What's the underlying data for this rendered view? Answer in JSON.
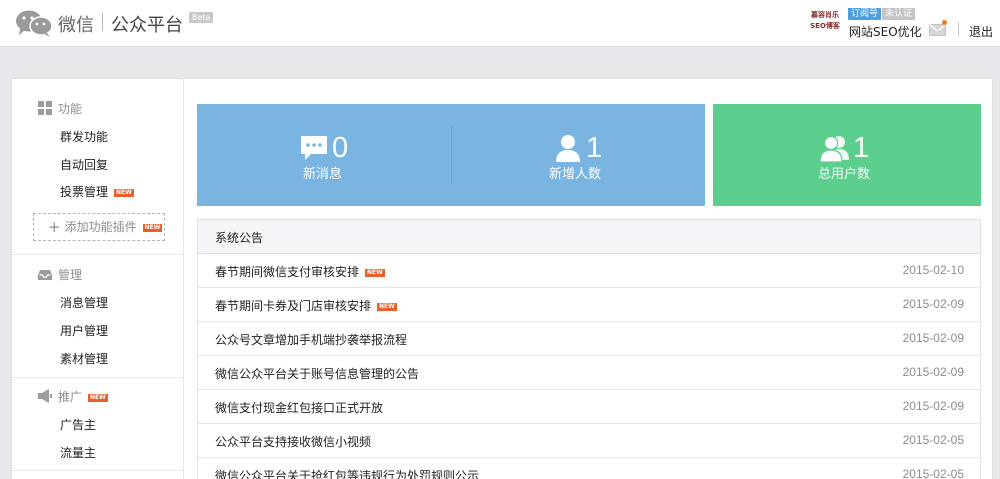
{
  "header": {
    "brand": "微信",
    "platform": "公众平台",
    "beta": "Beta",
    "account_logo_line1": "慕容肖乐",
    "account_logo_line2": "SEO博客",
    "account_type": "订阅号",
    "account_verify": "未认证",
    "account_name": "网站SEO优化",
    "logout": "退出"
  },
  "sidebar": {
    "groups": [
      {
        "title": "功能",
        "icon": "grid-icon"
      },
      {
        "title": "管理",
        "icon": "inbox-icon"
      },
      {
        "title": "推广",
        "icon": "megaphone-icon",
        "new": "NEW"
      }
    ],
    "function_items": [
      {
        "label": "群发功能"
      },
      {
        "label": "自动回复"
      },
      {
        "label": "投票管理",
        "new": "NEW"
      }
    ],
    "add_plugin": "添加功能插件",
    "add_plugin_new": "NEW",
    "manage_items": [
      {
        "label": "消息管理"
      },
      {
        "label": "用户管理"
      },
      {
        "label": "素材管理"
      }
    ],
    "promo_items": [
      {
        "label": "广告主"
      },
      {
        "label": "流量主"
      }
    ]
  },
  "stats": {
    "new_messages": {
      "value": "0",
      "label": "新消息",
      "icon": "chat-icon"
    },
    "new_followers": {
      "value": "1",
      "label": "新增人数",
      "icon": "user-icon"
    },
    "total_users": {
      "value": "1",
      "label": "总用户数",
      "icon": "users-icon"
    }
  },
  "notice": {
    "title": "系统公告",
    "items": [
      {
        "title": "春节期间微信支付审核安排",
        "new": "NEW",
        "date": "2015-02-10"
      },
      {
        "title": "春节期间卡券及门店审核安排",
        "new": "NEW",
        "date": "2015-02-09"
      },
      {
        "title": "公众号文章增加手机端抄袭举报流程",
        "date": "2015-02-09"
      },
      {
        "title": "微信公众平台关于账号信息管理的公告",
        "date": "2015-02-09"
      },
      {
        "title": "微信支付现金红包接口正式开放",
        "date": "2015-02-09"
      },
      {
        "title": "公众平台支持接收微信小视频",
        "date": "2015-02-05"
      },
      {
        "title": "微信公众平台关于抢红包等违规行为处罚规则公示",
        "date": "2015-02-05"
      }
    ]
  },
  "colors": {
    "stat_blue": "#7ab5e2",
    "stat_green": "#5ccf8e",
    "new_tag": "#e8612c",
    "account_type_badge": "#4d9fe0"
  }
}
